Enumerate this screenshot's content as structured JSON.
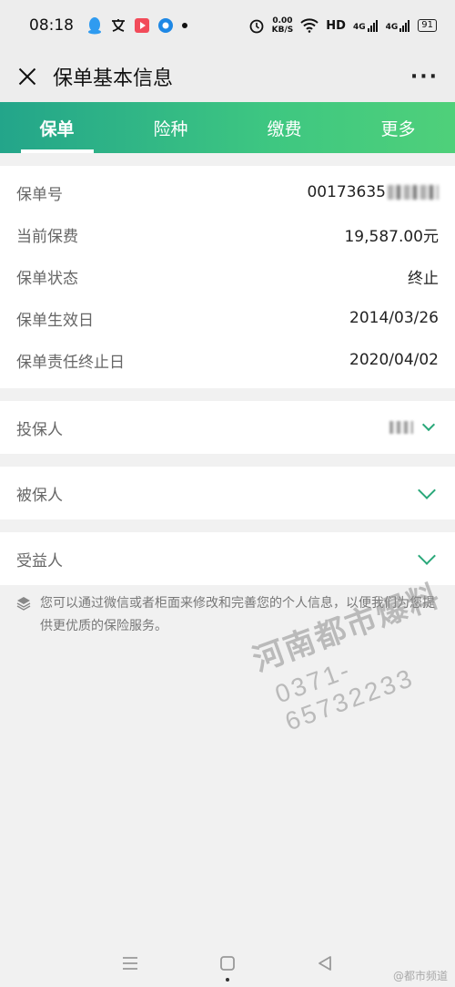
{
  "status_bar": {
    "time": "08:18",
    "speed_value": "0.00",
    "speed_unit": "KB/S",
    "hd_label": "HD",
    "net1": "4G",
    "net2": "4G",
    "battery": "91",
    "left_icons": [
      "qq-icon",
      "translate-icon",
      "video-app-icon",
      "browser-icon",
      "dot-icon"
    ]
  },
  "header": {
    "title": "保单基本信息",
    "more_label": "···"
  },
  "tabs": [
    {
      "label": "保单",
      "active": true
    },
    {
      "label": "险种",
      "active": false
    },
    {
      "label": "缴费",
      "active": false
    },
    {
      "label": "更多",
      "active": false
    }
  ],
  "policy_info": {
    "policy_number_label": "保单号",
    "policy_number_value": "00173635",
    "current_premium_label": "当前保费",
    "current_premium_value": "19,587.00元",
    "status_label": "保单状态",
    "status_value": "终止",
    "effective_date_label": "保单生效日",
    "effective_date_value": "2014/03/26",
    "end_date_label": "保单责任终止日",
    "end_date_value": "2020/04/02"
  },
  "parties": {
    "policyholder_label": "投保人",
    "insured_label": "被保人",
    "beneficiary_label": "受益人"
  },
  "notice_text": "您可以通过微信或者柜面来修改和完善您的个人信息，以便我们为您提供更优质的保险服务。",
  "watermark": {
    "title": "河南都市爆料",
    "phone": "0371-65732233"
  },
  "footer_mark": "@都市频道",
  "colors": {
    "tab_gradient_start": "#23a58a",
    "tab_gradient_end": "#4fd07a",
    "chevron": "#2aa87a"
  }
}
